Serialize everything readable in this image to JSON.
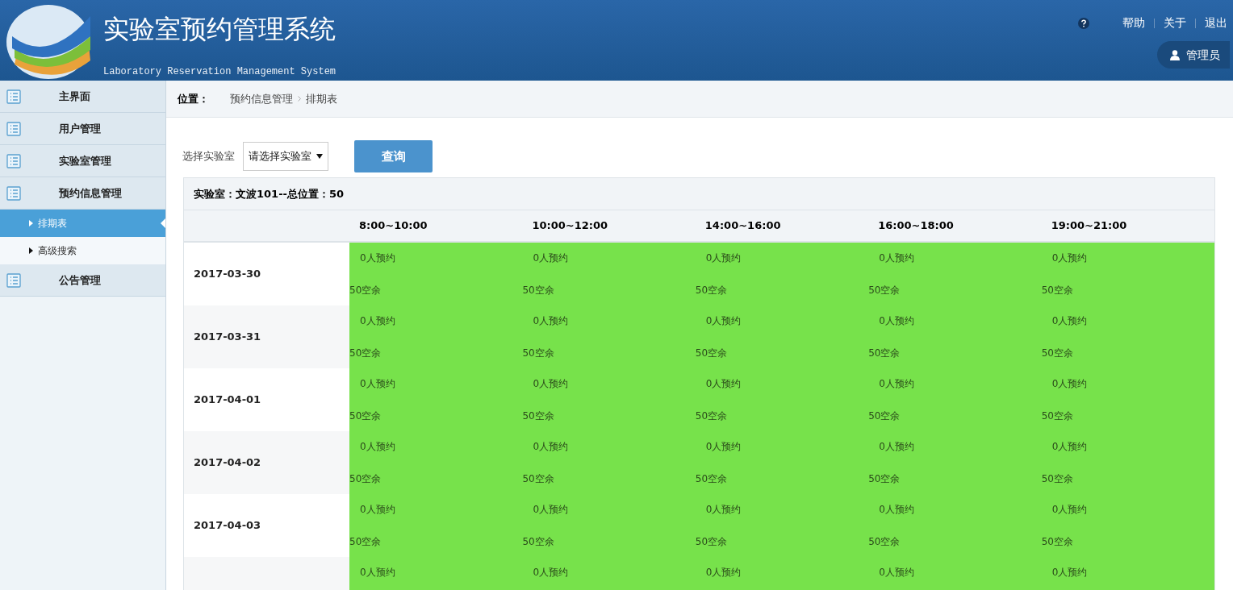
{
  "header": {
    "title": "实验室预约管理系统",
    "subtitle": "Laboratory Reservation Management System",
    "links": [
      "帮助",
      "关于",
      "退出"
    ],
    "user": "管理员"
  },
  "sidebar": {
    "items": [
      {
        "label": "主界面",
        "selected": false
      },
      {
        "label": "用户管理",
        "selected": false
      },
      {
        "label": "实验室管理",
        "selected": false
      },
      {
        "label": "预约信息管理",
        "selected": false,
        "children": [
          {
            "label": "排期表",
            "selected": true
          },
          {
            "label": "高级搜索",
            "selected": false
          }
        ]
      },
      {
        "label": "公告管理",
        "selected": false
      }
    ]
  },
  "breadcrumb": {
    "label": "位置：",
    "path": [
      "预约信息管理",
      "排期表"
    ]
  },
  "filter": {
    "label": "选择实验室",
    "select": {
      "value": "请选择实验室"
    },
    "button": "查询"
  },
  "table": {
    "caption": "实验室：文波101--总位置：50",
    "columns": [
      "8:00~10:00",
      "10:00~12:00",
      "14:00~16:00",
      "16:00~18:00",
      "19:00~21:00"
    ],
    "rows": [
      {
        "date": "2017-03-30",
        "cells": [
          {
            "reserved": "0人预约",
            "free": "50空余"
          },
          {
            "reserved": "0人预约",
            "free": "50空余"
          },
          {
            "reserved": "0人预约",
            "free": "50空余"
          },
          {
            "reserved": "0人预约",
            "free": "50空余"
          },
          {
            "reserved": "0人预约",
            "free": "50空余"
          }
        ]
      },
      {
        "date": "2017-03-31",
        "cells": [
          {
            "reserved": "0人预约",
            "free": "50空余"
          },
          {
            "reserved": "0人预约",
            "free": "50空余"
          },
          {
            "reserved": "0人预约",
            "free": "50空余"
          },
          {
            "reserved": "0人预约",
            "free": "50空余"
          },
          {
            "reserved": "0人预约",
            "free": "50空余"
          }
        ]
      },
      {
        "date": "2017-04-01",
        "cells": [
          {
            "reserved": "0人预约",
            "free": "50空余"
          },
          {
            "reserved": "0人预约",
            "free": "50空余"
          },
          {
            "reserved": "0人预约",
            "free": "50空余"
          },
          {
            "reserved": "0人预约",
            "free": "50空余"
          },
          {
            "reserved": "0人预约",
            "free": "50空余"
          }
        ]
      },
      {
        "date": "2017-04-02",
        "cells": [
          {
            "reserved": "0人预约",
            "free": "50空余"
          },
          {
            "reserved": "0人预约",
            "free": "50空余"
          },
          {
            "reserved": "0人预约",
            "free": "50空余"
          },
          {
            "reserved": "0人预约",
            "free": "50空余"
          },
          {
            "reserved": "0人预约",
            "free": "50空余"
          }
        ]
      },
      {
        "date": "2017-04-03",
        "cells": [
          {
            "reserved": "0人预约",
            "free": "50空余"
          },
          {
            "reserved": "0人预约",
            "free": "50空余"
          },
          {
            "reserved": "0人预约",
            "free": "50空余"
          },
          {
            "reserved": "0人预约",
            "free": "50空余"
          },
          {
            "reserved": "0人预约",
            "free": "50空余"
          }
        ]
      },
      {
        "cells": [
          {
            "reserved": "0人预约"
          },
          {
            "reserved": "0人预约"
          },
          {
            "reserved": "0人预约"
          },
          {
            "reserved": "0人预约"
          },
          {
            "reserved": "0人预约"
          }
        ]
      }
    ]
  }
}
